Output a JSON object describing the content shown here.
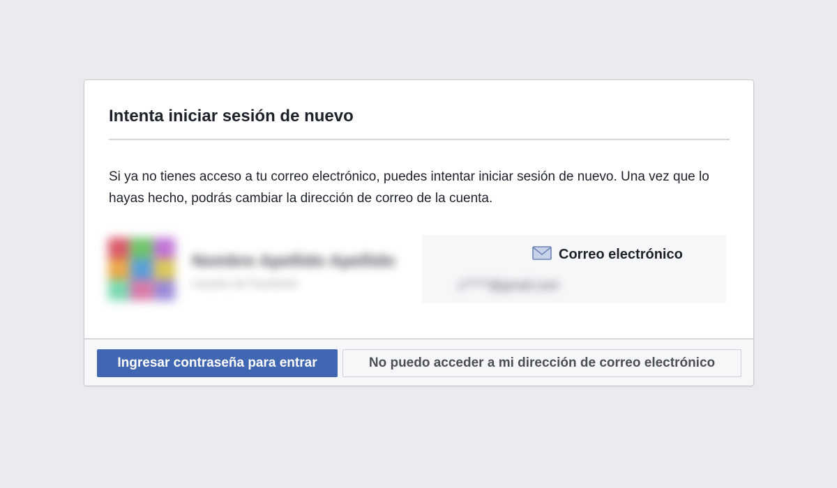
{
  "dialog": {
    "title": "Intenta iniciar sesión de nuevo",
    "description": "Si ya no tienes acceso a tu correo electrónico, puedes intentar iniciar sesión de nuevo. Una vez que lo hayas hecho, podrás cambiar la dirección de correo de la cuenta."
  },
  "account": {
    "name": "Nombre Apellido Apellido",
    "subtitle": "Usuario de Facebook"
  },
  "contact": {
    "icon": "mail-icon",
    "label": "Correo electrónico",
    "value": "c*****@gmail.com"
  },
  "footer": {
    "primary_label": "Ingresar contraseña para entrar",
    "secondary_label": "No puedo acceder a mi dirección de correo electrónico"
  },
  "colors": {
    "background": "#e9ebee",
    "primary_button": "#4267b2",
    "text": "#1d2129",
    "secondary_text": "#4b4f56"
  }
}
